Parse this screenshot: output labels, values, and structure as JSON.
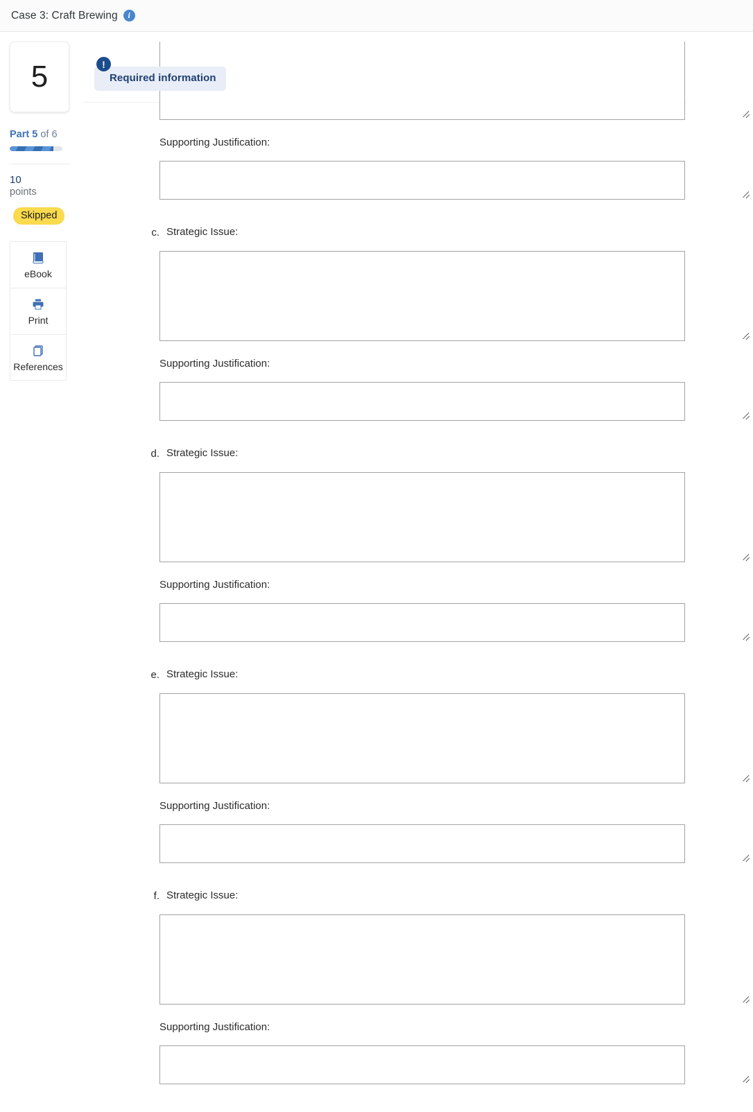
{
  "header": {
    "title": "Case 3: Craft Brewing",
    "info_icon": "info-icon"
  },
  "sidebar": {
    "part_number": "5",
    "part_prefix": "Part",
    "part_current": "5",
    "part_of": "of 6",
    "progress_percent": 83,
    "points_value": "10",
    "points_label": "points",
    "status_badge": "Skipped",
    "tools": [
      {
        "label": "eBook",
        "icon": "book-icon"
      },
      {
        "label": "Print",
        "icon": "printer-icon"
      },
      {
        "label": "References",
        "icon": "copy-pages-icon"
      }
    ]
  },
  "banner": {
    "text": "Required information",
    "icon": "alert-exclamation-icon"
  },
  "form": {
    "justification_label": "Supporting Justification:",
    "issue_label": "Strategic Issue:",
    "textarea_placeholder": "",
    "items": [
      {
        "marker": "",
        "issue_value": "",
        "justification_value": ""
      },
      {
        "marker": "c.",
        "issue_value": "",
        "justification_value": ""
      },
      {
        "marker": "d.",
        "issue_value": "",
        "justification_value": ""
      },
      {
        "marker": "e.",
        "issue_value": "",
        "justification_value": ""
      },
      {
        "marker": "f.",
        "issue_value": "",
        "justification_value": ""
      }
    ]
  },
  "colors": {
    "accent_blue": "#3f72b5",
    "banner_bg": "#e8edf7",
    "banner_text": "#1f3f70",
    "badge_yellow": "#fada4e",
    "border_grey": "#a3a3a3"
  }
}
